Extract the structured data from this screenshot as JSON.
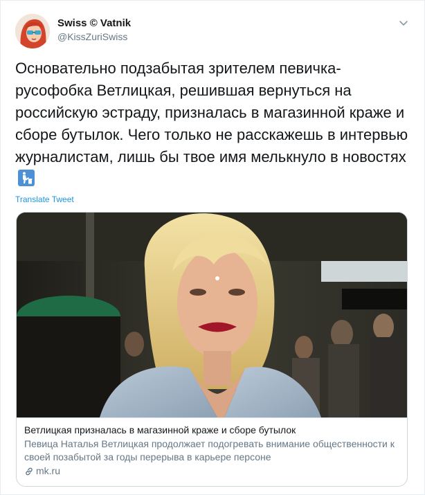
{
  "author": {
    "display_name": "Swiss © Vatnik",
    "handle": "@KissZuriSwiss"
  },
  "tweet": {
    "text": "Основательно подзабытая зрителем певичка-русофобка Ветлицкая, решившая вернуться на российскую эстраду, призналась в магазинной краже и сборе бутылок. Чего только не расскажешь в интервью журналистам, лишь бы твое имя мелькнуло в новостях",
    "emoji": "litter-in-bin-icon"
  },
  "translate_label": "Translate Tweet",
  "card": {
    "title": "Ветлицкая призналась в магазинной краже и сборе бутылок",
    "description": "Певица Наталья Ветлицкая продолжает подогревать внимание общественности к своей позабытой за годы перерыва в карьере персоне",
    "domain": "mk.ru"
  },
  "colors": {
    "link": "#1b95e0",
    "secondary_text": "#657786",
    "border": "#ccd6dd",
    "emoji_bg": "#4d90d6"
  }
}
